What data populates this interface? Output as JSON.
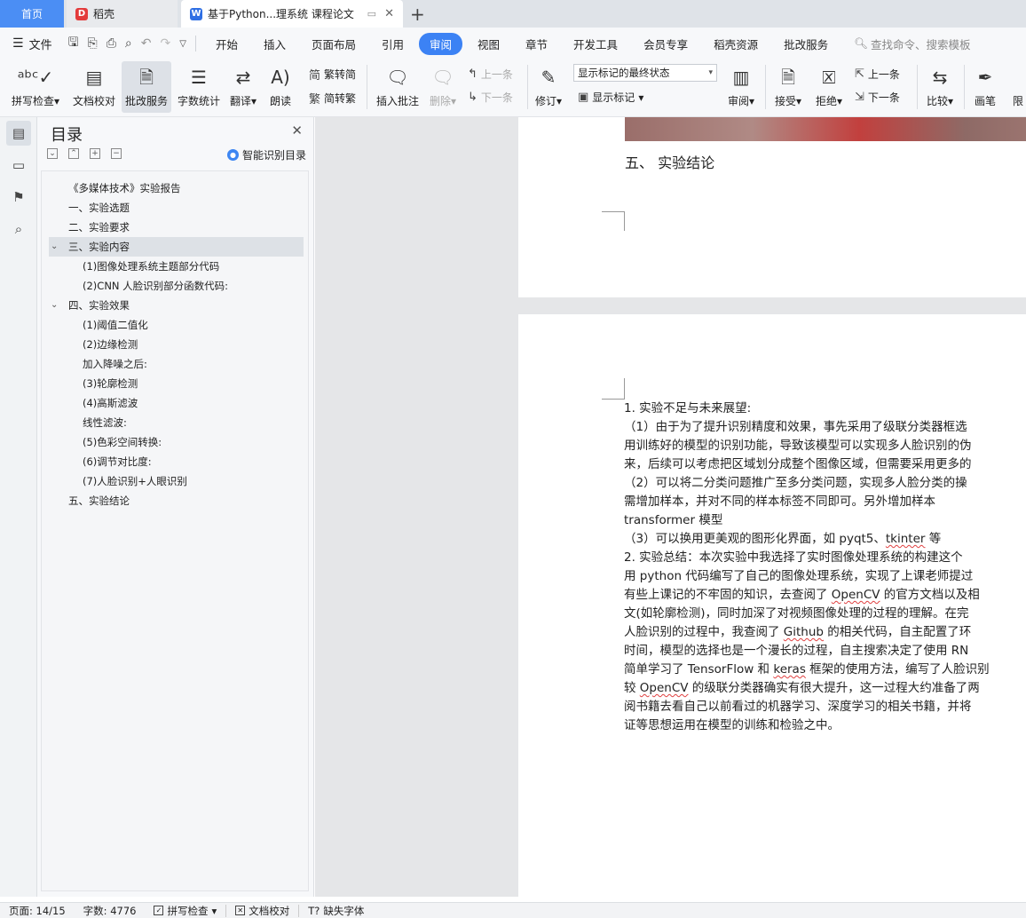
{
  "tabs": {
    "home": "首页",
    "daoke": "稻壳",
    "doc": "基于Python...理系统 课程论文"
  },
  "menubar": {
    "file": "文件",
    "items": [
      "开始",
      "插入",
      "页面布局",
      "引用",
      "审阅",
      "视图",
      "章节",
      "开发工具",
      "会员专享",
      "稻壳资源",
      "批改服务"
    ],
    "active": "审阅",
    "search": "查找命令、搜索模板"
  },
  "ribbon": {
    "spell": "拼写检查",
    "doccheck": "文档校对",
    "review_service": "批改服务",
    "wordcount": "字数统计",
    "translate": "翻译",
    "read": "朗读",
    "trad": "繁转简",
    "simp": "简转繁",
    "insert_comment": "插入批注",
    "delete": "删除",
    "prev1": "上一条",
    "next1": "下一条",
    "revise": "修订",
    "markup_state": "显示标记的最终状态",
    "show_markup": "显示标记",
    "review": "审阅",
    "accept": "接受",
    "reject": "拒绝",
    "prev2": "上一条",
    "next2": "下一条",
    "compare": "比较",
    "pen": "画笔",
    "restrict": "限"
  },
  "toc": {
    "title": "目录",
    "smart": "智能识别目录",
    "items": [
      "《多媒体技术》实验报告",
      "一、实验选题",
      "二、实验要求",
      "三、实验内容",
      "(1)图像处理系统主题部分代码",
      "(2)CNN 人脸识别部分函数代码:",
      "四、实验效果",
      "(1)阈值二值化",
      "(2)边缘检测",
      "加入降噪之后:",
      "(3)轮廓检测",
      "(4)高斯滤波",
      "线性滤波:",
      "(5)色彩空间转换:",
      "(6)调节对比度:",
      "(7)人脸识别+人眼识别",
      "五、实验结论"
    ]
  },
  "document": {
    "section5": "五、   实验结论",
    "lines": [
      "1. 实验不足与未来展望:",
      "（1）由于为了提升识别精度和效果，事先采用了级联分类器框选",
      "用训练好的模型的识别功能，导致该模型可以实现多人脸识别的伪",
      "来，后续可以考虑把区域划分成整个图像区域，但需要采用更多的",
      "（2）可以将二分类问题推广至多分类问题，实现多人脸分类的操",
      "需增加样本，并对不同的样本标签不同即可。另外增加样本",
      "transformer 模型",
      "（3）可以换用更美观的图形化界面，如 pyqt5、tkinter 等",
      "2. 实验总结：本次实验中我选择了实时图像处理系统的构建这个",
      "用 python 代码编写了自己的图像处理系统，实现了上课老师提过",
      "有些上课记的不牢固的知识，去查阅了 OpenCV 的官方文档以及相",
      "文(如轮廓检测)，同时加深了对视频图像处理的过程的理解。在完",
      "人脸识别的过程中，我查阅了 Github 的相关代码，自主配置了环",
      "时间，模型的选择也是一个漫长的过程，自主搜索决定了使用 RN",
      "简单学习了 TensorFlow 和 keras 框架的使用方法，编写了人脸识别",
      "较 OpenCV 的级联分类器确实有很大提升，这一过程大约准备了两",
      "阅书籍去看自己以前看过的机器学习、深度学习的相关书籍，并将",
      "证等思想运用在模型的训练和检验之中。"
    ]
  },
  "status": {
    "page": "页面: 14/15",
    "words": "字数: 4776",
    "spell": "拼写检查",
    "doccheck": "文档校对",
    "missing_font": "缺失字体"
  }
}
